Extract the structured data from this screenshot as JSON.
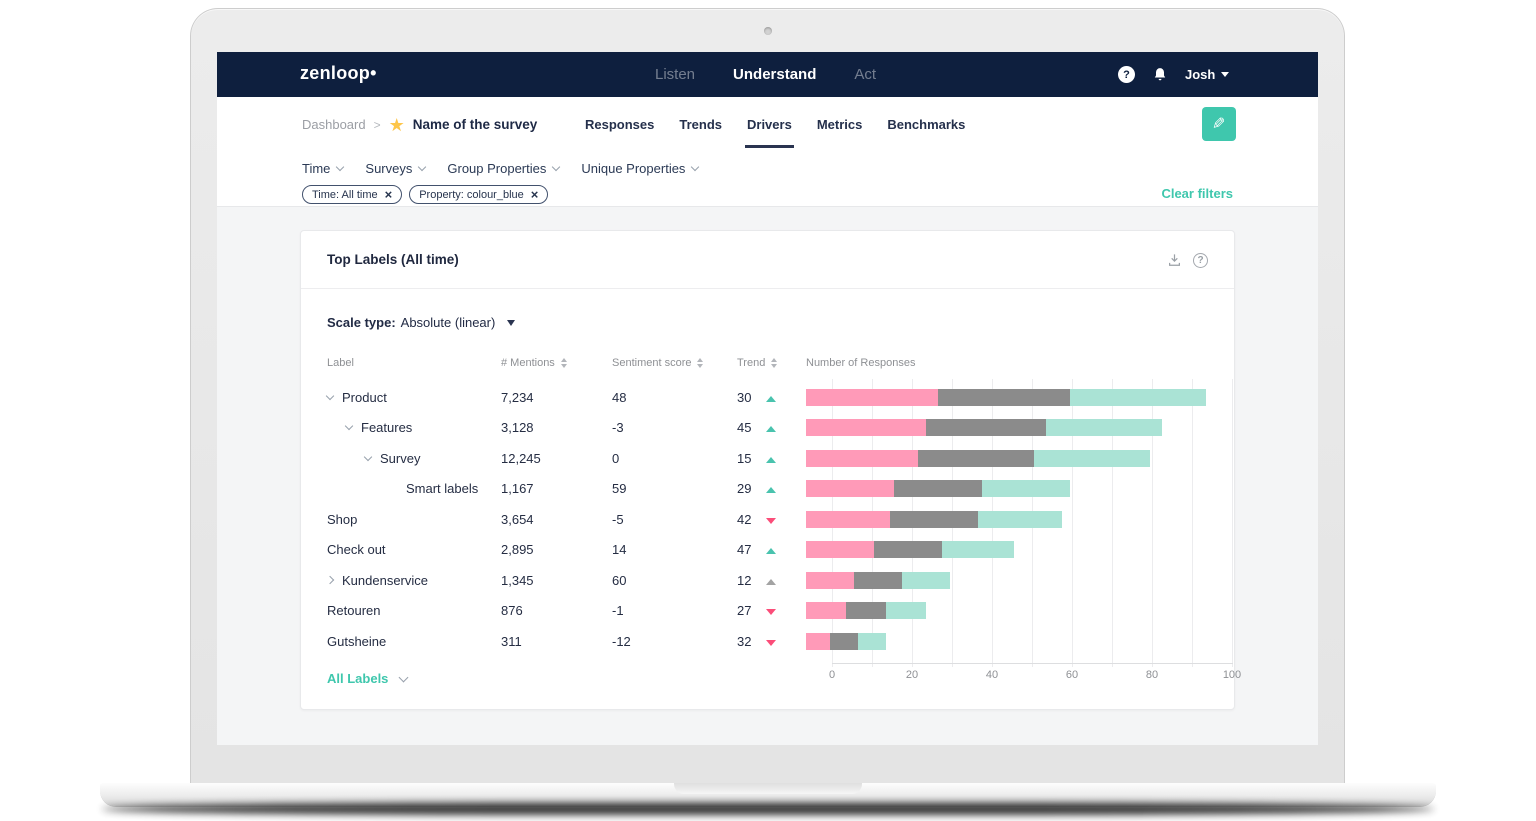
{
  "icons": {
    "close": "×",
    "star": "★",
    "pencil": "✎",
    "help": "?",
    "question": "?",
    "dot": "•",
    "breadcrumb_sep": ">"
  },
  "navbar": {
    "logo": "zenloop",
    "items": [
      {
        "label": "Listen",
        "active": false
      },
      {
        "label": "Understand",
        "active": true
      },
      {
        "label": "Act",
        "active": false
      }
    ],
    "user": "Josh"
  },
  "subnav": {
    "breadcrumb": "Dashboard",
    "survey_name": "Name of the survey",
    "tabs": [
      {
        "label": "Responses",
        "active": false
      },
      {
        "label": "Trends",
        "active": false
      },
      {
        "label": "Drivers",
        "active": true
      },
      {
        "label": "Metrics",
        "active": false
      },
      {
        "label": "Benchmarks",
        "active": false
      }
    ]
  },
  "filters": {
    "dropdowns": [
      "Time",
      "Surveys",
      "Group Properties",
      "Unique Properties"
    ],
    "chips": [
      {
        "text": "Time: All time"
      },
      {
        "text": "Property: colour_blue"
      }
    ],
    "clear_label": "Clear filters"
  },
  "card": {
    "title": "Top Labels (All time)",
    "scale_label": "Scale type:",
    "scale_value": "Absolute (linear)",
    "columns": {
      "label": "Label",
      "mentions": "# Mentions",
      "sentiment": "Sentiment score",
      "trend": "Trend"
    },
    "footer_link": "All Labels"
  },
  "rows": [
    {
      "label": "Product",
      "indent": 0,
      "chevron": "down",
      "mentions": "7,234",
      "sentiment": "48",
      "trend": "30",
      "trend_dir": "up"
    },
    {
      "label": "Features",
      "indent": 1,
      "chevron": "down",
      "mentions": "3,128",
      "sentiment": "-3",
      "trend": "45",
      "trend_dir": "up"
    },
    {
      "label": "Survey",
      "indent": 2,
      "chevron": "down",
      "mentions": "12,245",
      "sentiment": "0",
      "trend": "15",
      "trend_dir": "up"
    },
    {
      "label": "Smart labels",
      "indent": 3,
      "chevron": "none",
      "mentions": "1,167",
      "sentiment": "59",
      "trend": "29",
      "trend_dir": "up"
    },
    {
      "label": "Shop",
      "indent": 0,
      "chevron": "none",
      "mentions": "3,654",
      "sentiment": "-5",
      "trend": "42",
      "trend_dir": "down"
    },
    {
      "label": "Check out",
      "indent": 0,
      "chevron": "none",
      "mentions": "2,895",
      "sentiment": "14",
      "trend": "47",
      "trend_dir": "up"
    },
    {
      "label": "Kundenservice",
      "indent": 0,
      "chevron": "right",
      "mentions": "1,345",
      "sentiment": "60",
      "trend": "12",
      "trend_dir": "up-neutral"
    },
    {
      "label": "Retouren",
      "indent": 0,
      "chevron": "none",
      "mentions": "876",
      "sentiment": "-1",
      "trend": "27",
      "trend_dir": "down"
    },
    {
      "label": "Gutsheine",
      "indent": 0,
      "chevron": "none",
      "mentions": "311",
      "sentiment": "-12",
      "trend": "32",
      "trend_dir": "down"
    }
  ],
  "chart_data": {
    "type": "bar",
    "orientation": "horizontal",
    "stacked": true,
    "title": "Number of Responses",
    "xlim": [
      0,
      100
    ],
    "ticks": [
      0,
      20,
      40,
      60,
      80,
      100
    ],
    "minor_grid_step": 10,
    "grid": true,
    "legend": "none",
    "categories": [
      "Product",
      "Features",
      "Survey",
      "Smart labels",
      "Shop",
      "Check out",
      "Kundenservice",
      "Retouren",
      "Gutsheine"
    ],
    "series": [
      {
        "name": "pink",
        "color": "#ff9ab8",
        "values": [
          33,
          30,
          28,
          22,
          21,
          17,
          12,
          10,
          6
        ]
      },
      {
        "name": "gray",
        "color": "#8b8b8b",
        "values": [
          33,
          30,
          29,
          22,
          22,
          17,
          12,
          10,
          7
        ]
      },
      {
        "name": "teal",
        "color": "#aae3d5",
        "values": [
          34,
          29,
          29,
          22,
          21,
          18,
          12,
          10,
          7
        ]
      }
    ]
  },
  "colors": {
    "navbar_bg": "#0e1f3e",
    "accent_teal": "#3fc7ad",
    "trend_up": "#49c3ae",
    "trend_down": "#fb4d79",
    "trend_neutral": "#a3a3a3",
    "star_gold": "#fdc64a",
    "text_dark": "#222b45",
    "text_gray": "#8f9298"
  }
}
